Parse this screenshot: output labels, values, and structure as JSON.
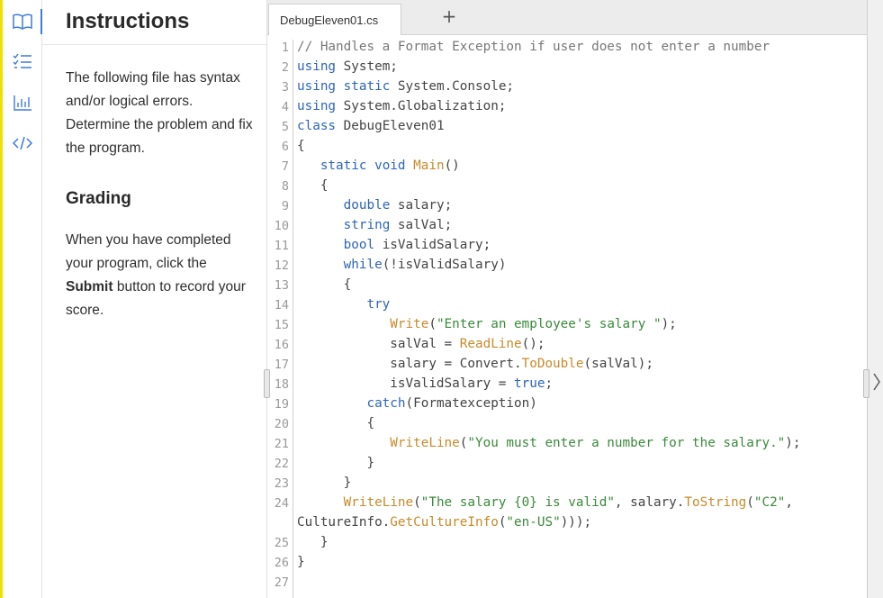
{
  "sidebar": {
    "icons": [
      "book-icon",
      "checklist-icon",
      "bar-chart-icon",
      "code-icon"
    ],
    "accent": "#3d7bd9"
  },
  "instructions": {
    "title": "Instructions",
    "intro": "The following file has syntax and/or logical errors. Determine the problem and fix the program.",
    "grading_heading": "Grading",
    "grading_before": "When you have completed your program, click the ",
    "grading_bold": "Submit",
    "grading_after": " button to record your score."
  },
  "editor": {
    "tab_label": "DebugEleven01.cs",
    "add_tab_label": "+",
    "line_numbers": [
      "1",
      "2",
      "3",
      "4",
      "5",
      "6",
      "7",
      "8",
      "9",
      "10",
      "11",
      "12",
      "13",
      "14",
      "15",
      "16",
      "17",
      "18",
      "19",
      "20",
      "21",
      "22",
      "23",
      "24",
      "25",
      "26",
      "27"
    ],
    "code_lines": [
      "// Handles a Format Exception if user does not enter a number",
      "using System;",
      "using static System.Console;",
      "using System.Globalization;",
      "class DebugEleven01",
      "{",
      "   static void Main()",
      "   {",
      "      double salary;",
      "      string salVal;",
      "      bool isValidSalary;",
      "      while(!isValidSalary)",
      "      {",
      "         try",
      "            Write(\"Enter an employee's salary \");",
      "            salVal = ReadLine();",
      "            salary = Convert.ToDouble(salVal);",
      "            isValidSalary = true;",
      "         catch(Formatexception)",
      "         {",
      "            WriteLine(\"You must enter a number for the salary.\");",
      "         }",
      "      }",
      "      WriteLine(\"The salary {0} is valid\", salary.ToString(\"C2\",",
      "CultureInfo.GetCultureInfo(\"en-US\")));",
      "   }",
      "}",
      ""
    ]
  }
}
